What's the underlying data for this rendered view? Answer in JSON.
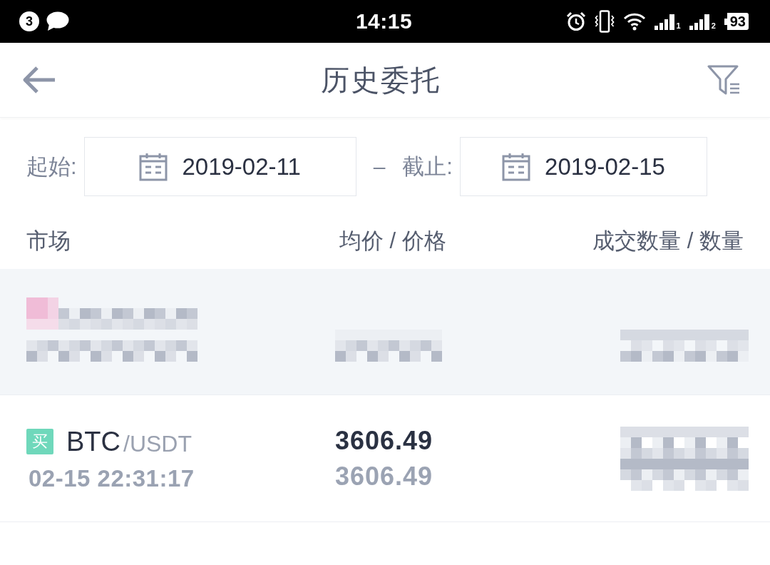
{
  "status_bar": {
    "notification_count": "3",
    "time": "14:15",
    "sim_slots": [
      "1",
      "2"
    ],
    "battery": "93"
  },
  "nav": {
    "title": "历史委托"
  },
  "date_range": {
    "start_label": "起始:",
    "start_date": "2019-02-11",
    "separator": "–",
    "end_label": "截止:",
    "end_date": "2019-02-15"
  },
  "table": {
    "columns": [
      "市场",
      "均价 / 价格",
      "成交数量 / 数量"
    ],
    "rows": [
      {
        "kind": "redacted",
        "selected": true
      },
      {
        "kind": "order",
        "selected": false,
        "side": "买",
        "base": "BTC",
        "quote": "/USDT",
        "time": "02-15 22:31:17",
        "avg_price": "3606.49",
        "price": "3606.49",
        "quantity_redacted": true
      }
    ]
  }
}
